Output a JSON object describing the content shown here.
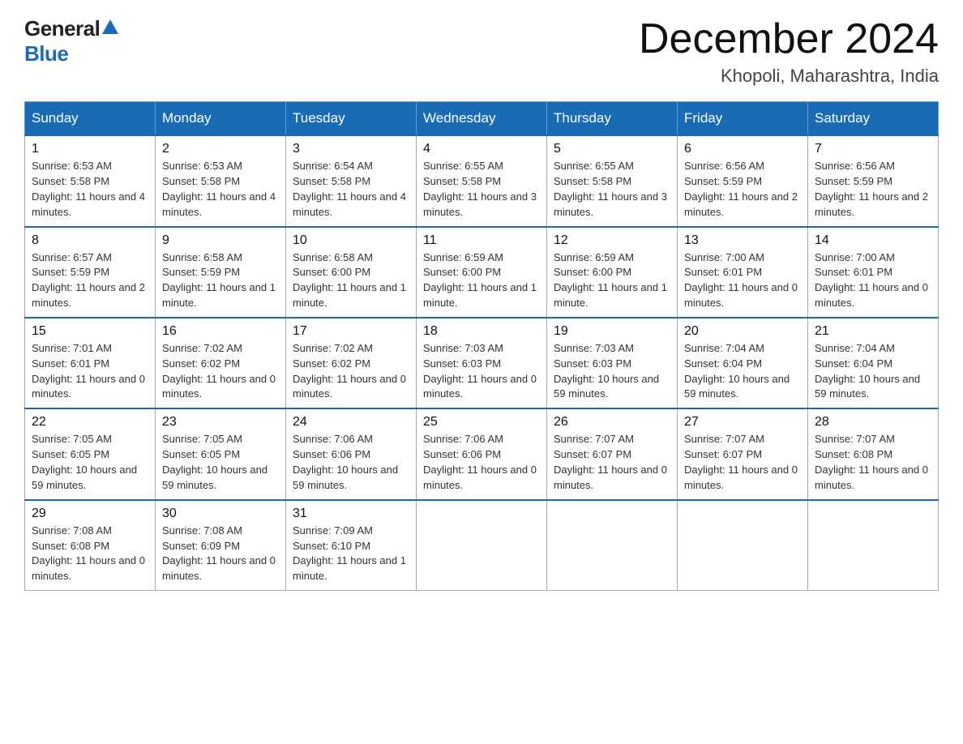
{
  "logo": {
    "general": "General",
    "blue": "Blue"
  },
  "header": {
    "month_year": "December 2024",
    "location": "Khopoli, Maharashtra, India"
  },
  "days_of_week": [
    "Sunday",
    "Monday",
    "Tuesday",
    "Wednesday",
    "Thursday",
    "Friday",
    "Saturday"
  ],
  "weeks": [
    [
      {
        "day": "1",
        "sunrise": "6:53 AM",
        "sunset": "5:58 PM",
        "daylight": "11 hours and 4 minutes."
      },
      {
        "day": "2",
        "sunrise": "6:53 AM",
        "sunset": "5:58 PM",
        "daylight": "11 hours and 4 minutes."
      },
      {
        "day": "3",
        "sunrise": "6:54 AM",
        "sunset": "5:58 PM",
        "daylight": "11 hours and 4 minutes."
      },
      {
        "day": "4",
        "sunrise": "6:55 AM",
        "sunset": "5:58 PM",
        "daylight": "11 hours and 3 minutes."
      },
      {
        "day": "5",
        "sunrise": "6:55 AM",
        "sunset": "5:58 PM",
        "daylight": "11 hours and 3 minutes."
      },
      {
        "day": "6",
        "sunrise": "6:56 AM",
        "sunset": "5:59 PM",
        "daylight": "11 hours and 2 minutes."
      },
      {
        "day": "7",
        "sunrise": "6:56 AM",
        "sunset": "5:59 PM",
        "daylight": "11 hours and 2 minutes."
      }
    ],
    [
      {
        "day": "8",
        "sunrise": "6:57 AM",
        "sunset": "5:59 PM",
        "daylight": "11 hours and 2 minutes."
      },
      {
        "day": "9",
        "sunrise": "6:58 AM",
        "sunset": "5:59 PM",
        "daylight": "11 hours and 1 minute."
      },
      {
        "day": "10",
        "sunrise": "6:58 AM",
        "sunset": "6:00 PM",
        "daylight": "11 hours and 1 minute."
      },
      {
        "day": "11",
        "sunrise": "6:59 AM",
        "sunset": "6:00 PM",
        "daylight": "11 hours and 1 minute."
      },
      {
        "day": "12",
        "sunrise": "6:59 AM",
        "sunset": "6:00 PM",
        "daylight": "11 hours and 1 minute."
      },
      {
        "day": "13",
        "sunrise": "7:00 AM",
        "sunset": "6:01 PM",
        "daylight": "11 hours and 0 minutes."
      },
      {
        "day": "14",
        "sunrise": "7:00 AM",
        "sunset": "6:01 PM",
        "daylight": "11 hours and 0 minutes."
      }
    ],
    [
      {
        "day": "15",
        "sunrise": "7:01 AM",
        "sunset": "6:01 PM",
        "daylight": "11 hours and 0 minutes."
      },
      {
        "day": "16",
        "sunrise": "7:02 AM",
        "sunset": "6:02 PM",
        "daylight": "11 hours and 0 minutes."
      },
      {
        "day": "17",
        "sunrise": "7:02 AM",
        "sunset": "6:02 PM",
        "daylight": "11 hours and 0 minutes."
      },
      {
        "day": "18",
        "sunrise": "7:03 AM",
        "sunset": "6:03 PM",
        "daylight": "11 hours and 0 minutes."
      },
      {
        "day": "19",
        "sunrise": "7:03 AM",
        "sunset": "6:03 PM",
        "daylight": "10 hours and 59 minutes."
      },
      {
        "day": "20",
        "sunrise": "7:04 AM",
        "sunset": "6:04 PM",
        "daylight": "10 hours and 59 minutes."
      },
      {
        "day": "21",
        "sunrise": "7:04 AM",
        "sunset": "6:04 PM",
        "daylight": "10 hours and 59 minutes."
      }
    ],
    [
      {
        "day": "22",
        "sunrise": "7:05 AM",
        "sunset": "6:05 PM",
        "daylight": "10 hours and 59 minutes."
      },
      {
        "day": "23",
        "sunrise": "7:05 AM",
        "sunset": "6:05 PM",
        "daylight": "10 hours and 59 minutes."
      },
      {
        "day": "24",
        "sunrise": "7:06 AM",
        "sunset": "6:06 PM",
        "daylight": "10 hours and 59 minutes."
      },
      {
        "day": "25",
        "sunrise": "7:06 AM",
        "sunset": "6:06 PM",
        "daylight": "11 hours and 0 minutes."
      },
      {
        "day": "26",
        "sunrise": "7:07 AM",
        "sunset": "6:07 PM",
        "daylight": "11 hours and 0 minutes."
      },
      {
        "day": "27",
        "sunrise": "7:07 AM",
        "sunset": "6:07 PM",
        "daylight": "11 hours and 0 minutes."
      },
      {
        "day": "28",
        "sunrise": "7:07 AM",
        "sunset": "6:08 PM",
        "daylight": "11 hours and 0 minutes."
      }
    ],
    [
      {
        "day": "29",
        "sunrise": "7:08 AM",
        "sunset": "6:08 PM",
        "daylight": "11 hours and 0 minutes."
      },
      {
        "day": "30",
        "sunrise": "7:08 AM",
        "sunset": "6:09 PM",
        "daylight": "11 hours and 0 minutes."
      },
      {
        "day": "31",
        "sunrise": "7:09 AM",
        "sunset": "6:10 PM",
        "daylight": "11 hours and 1 minute."
      },
      null,
      null,
      null,
      null
    ]
  ],
  "labels": {
    "sunrise": "Sunrise:",
    "sunset": "Sunset:",
    "daylight": "Daylight:"
  }
}
